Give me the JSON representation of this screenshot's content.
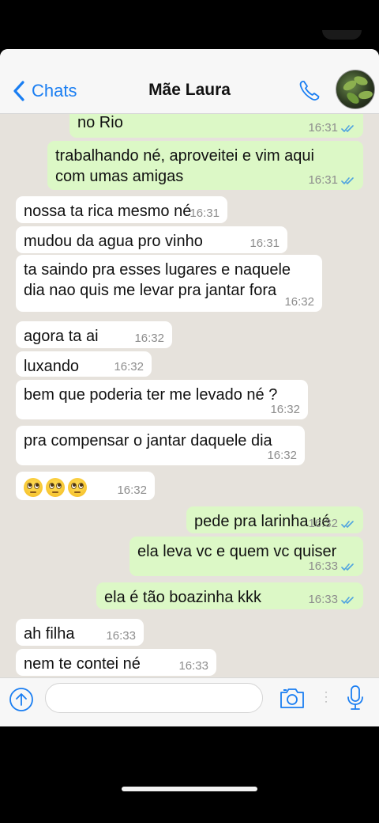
{
  "header": {
    "back_label": "Chats",
    "title": "Mãe Laura"
  },
  "messages": [
    {
      "dir": "out",
      "text": "no Rio",
      "time": "16:31",
      "read": true
    },
    {
      "dir": "out",
      "text": "trabalhando né, aproveitei e vim aqui\ncom umas amigas",
      "time": "16:31",
      "read": true
    },
    {
      "dir": "in",
      "text": "nossa ta rica mesmo né",
      "time": "16:31"
    },
    {
      "dir": "in",
      "text": "mudou da agua pro vinho",
      "time": "16:31"
    },
    {
      "dir": "in",
      "text": "ta saindo pra esses lugares e naquele\ndia nao quis me levar pra jantar fora",
      "time": "16:32"
    },
    {
      "dir": "in",
      "text": "agora ta ai",
      "time": "16:32"
    },
    {
      "dir": "in",
      "text": "luxando",
      "time": "16:32"
    },
    {
      "dir": "in",
      "text": "bem que poderia ter me levado né ?",
      "time": "16:32"
    },
    {
      "dir": "in",
      "text": "pra compensar o jantar daquele dia",
      "time": "16:32"
    },
    {
      "dir": "in",
      "text": "🙄🙄🙄",
      "emoji_name": "face-with-rolling-eyes",
      "time": "16:32"
    },
    {
      "dir": "out",
      "text": "pede pra larinha ué",
      "time": "16:32",
      "read": true
    },
    {
      "dir": "out",
      "text": "ela leva vc e quem vc quiser",
      "time": "16:33",
      "read": true
    },
    {
      "dir": "out",
      "text": "ela é tão boazinha kkk",
      "time": "16:33",
      "read": true
    },
    {
      "dir": "in",
      "text": "ah filha",
      "time": "16:33"
    },
    {
      "dir": "in",
      "text": "nem te contei né",
      "time": "16:33"
    }
  ],
  "icons": {
    "back": "chevron-left-icon",
    "call": "phone-icon",
    "attach": "upload-arrow-icon",
    "camera": "camera-icon",
    "mic": "microphone-icon",
    "read_receipt": "double-check-icon"
  },
  "colors": {
    "accent": "#1a7ef2",
    "outgoing_bubble": "#dcf8c6",
    "incoming_bubble": "#ffffff",
    "chat_background": "#e6e2dc",
    "read_ticks": "#4fa3e0"
  },
  "input": {
    "value": "",
    "placeholder": ""
  }
}
